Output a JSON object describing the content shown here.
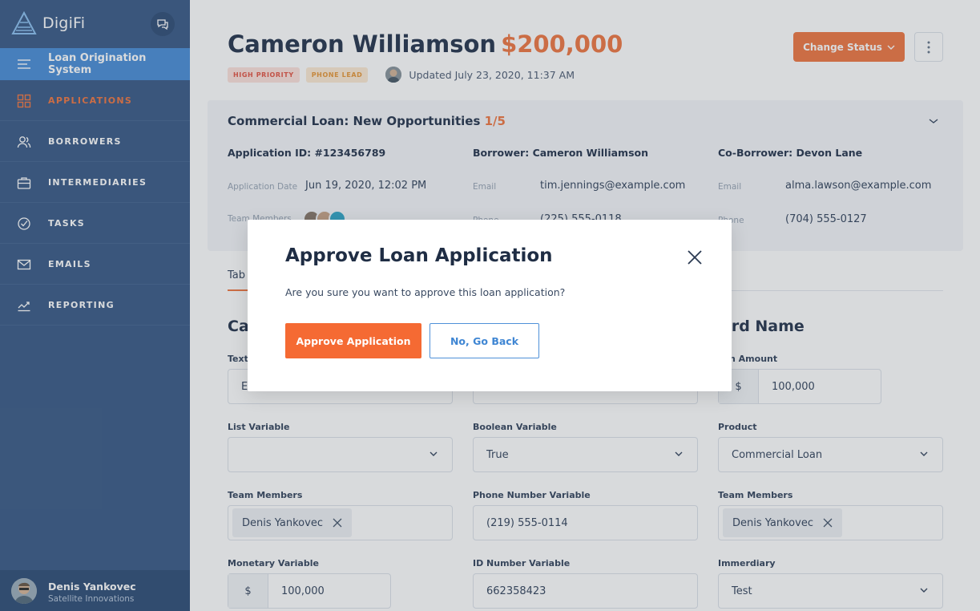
{
  "app": {
    "brand": "DigiFi"
  },
  "sidebar": {
    "system_item": "Loan Origination System",
    "items": [
      {
        "label": "APPLICATIONS",
        "icon": "grid-icon"
      },
      {
        "label": "BORROWERS",
        "icon": "users-icon"
      },
      {
        "label": "INTERMEDIARIES",
        "icon": "briefcase-icon"
      },
      {
        "label": "TASKS",
        "icon": "check-circle-icon"
      },
      {
        "label": "EMAILS",
        "icon": "mail-icon"
      },
      {
        "label": "REPORTING",
        "icon": "chart-icon"
      }
    ],
    "active_item": "APPLICATIONS",
    "user": {
      "name": "Denis Yankovec",
      "company": "Satellite Innovations"
    }
  },
  "header": {
    "name": "Cameron Williamson",
    "amount": "$200,000",
    "tags": [
      "HIGH PRIORITY",
      "PHONE LEAD"
    ],
    "updated": "Updated July 23, 2020, 11:37 AM",
    "change_status": "Change Status"
  },
  "opportunity": {
    "title": "Commercial Loan: New Opportunities",
    "count": "1/5",
    "application_id": "Application ID: #123456789",
    "borrower": "Borrower: Cameron Williamson",
    "co_borrower": "Co-Borrower: Devon Lane",
    "app_date_label": "Application Date",
    "app_date": "Jun 19, 2020, 12:02 PM",
    "team_label": "Team Members",
    "email_label": "Email",
    "borrower_email": "tim.jennings@example.com",
    "co_borrower_email": "alma.lawson@example.com",
    "phone_label": "Phone",
    "borrower_phone": "(225) 555-0118",
    "co_borrower_phone": "(704) 555-0127"
  },
  "tabs": {
    "first": "Tab"
  },
  "form": {
    "section_left": "Ca",
    "section_right": "ard Name",
    "text_label": "Text",
    "text_value": "E",
    "loan_amount_label": "n Amount",
    "loan_currency": "$",
    "loan_amount": "100,000",
    "list_variable_label": "List Variable",
    "boolean_variable_label": "Boolean Variable",
    "boolean_value": "True",
    "product_label": "Product",
    "product_value": "Commercial Loan",
    "team_members_label": "Team Members",
    "team_member_chip": "Denis Yankovec",
    "phone_variable_label": "Phone Number Variable",
    "phone_variable_value": "(219) 555-0114",
    "monetary_label": "Monetary Variable",
    "monetary_currency": "$",
    "monetary_value": "100,000",
    "id_number_label": "ID Number Variable",
    "id_number_value": "662358423",
    "immerdiary_label": "Immerdiary",
    "immerdiary_value": "Test"
  },
  "modal": {
    "title": "Approve Loan Application",
    "message": "Are you sure you want to approve this loan application?",
    "approve": "Approve Application",
    "cancel": "No, Go Back"
  },
  "colors": {
    "accent": "#f07a47",
    "sidebar": "#3f5f8a",
    "active_blue": "#4f91d8",
    "approve": "#f56a33"
  }
}
